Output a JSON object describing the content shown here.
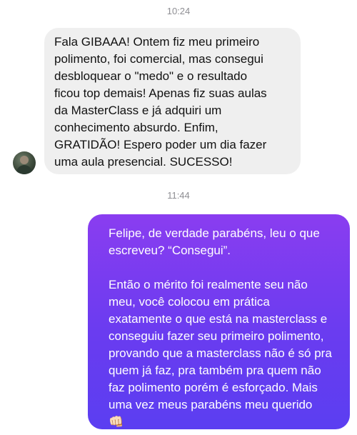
{
  "conversation": {
    "timestamps": [
      "10:24",
      "11:44"
    ],
    "incoming": {
      "text": "Fala GIBAAA! Ontem fiz meu primeiro\npolimento, foi comercial, mas consegui\ndesbloquear o \"medo\" e o resultado\nficou top demais! Apenas fiz suas aulas\nda MasterClass e já adquiri um\nconhecimento absurdo. Enfim,\nGRATIDÃO! Espero poder um dia fazer\numa aula presencial. SUCESSO!"
    },
    "outgoing": {
      "paragraph_1": "Felipe, de verdade parabéns, leu o que\nescreveu? “Consegui”.",
      "paragraph_2": "Então o mérito foi realmente seu não\nmeu, você colocou em prática\nexatamente o que está na masterclass e\nconseguiu fazer seu primeiro polimento,\nprovando que a masterclass não é só pra\nquem já faz, pra também pra quem não\nfaz polimento porém é esforçado. Mais\numa vez meus parabéns meu querido",
      "emoji": "👊🏻",
      "emoji_icon": "fist-bump-icon"
    },
    "colors": {
      "incoming_bubble": "#efefef",
      "outgoing_gradient_top": "#8a3df0",
      "outgoing_gradient_bottom": "#5b3ef1"
    }
  }
}
